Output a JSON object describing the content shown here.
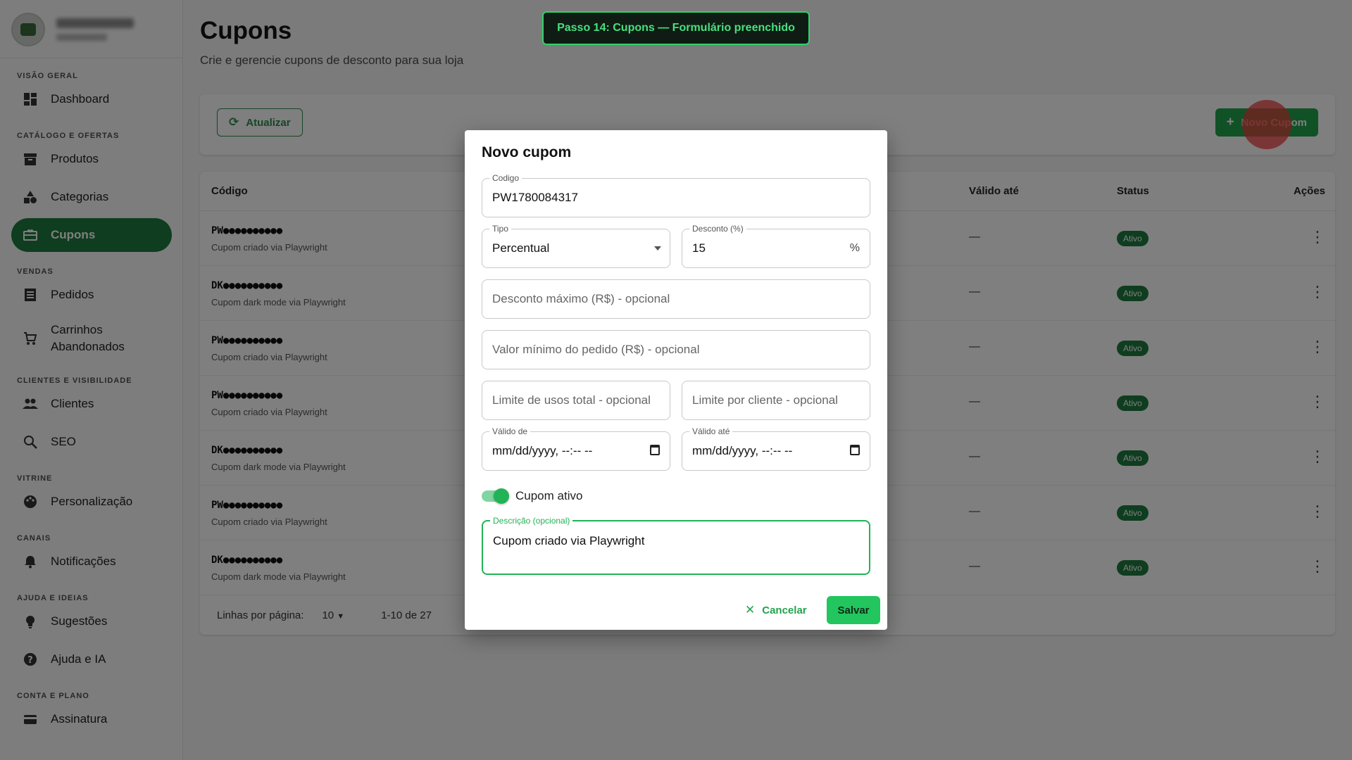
{
  "sidebar": {
    "sections": [
      {
        "label": "VISÃO GERAL",
        "items": [
          {
            "label": "Dashboard",
            "icon": "dashboard-icon"
          }
        ]
      },
      {
        "label": "CATÁLOGO E OFERTAS",
        "items": [
          {
            "label": "Produtos",
            "icon": "archive-icon"
          },
          {
            "label": "Categorias",
            "icon": "category-icon"
          },
          {
            "label": "Cupons",
            "icon": "coupon-icon"
          }
        ]
      },
      {
        "label": "VENDAS",
        "items": [
          {
            "label": "Pedidos",
            "icon": "list-icon"
          },
          {
            "label": "Carrinhos Abandonados",
            "icon": "cart-icon"
          }
        ]
      },
      {
        "label": "CLIENTES E VISIBILIDADE",
        "items": [
          {
            "label": "Clientes",
            "icon": "people-icon"
          },
          {
            "label": "SEO",
            "icon": "search-icon"
          }
        ]
      },
      {
        "label": "VITRINE",
        "items": [
          {
            "label": "Personalização",
            "icon": "palette-icon"
          }
        ]
      },
      {
        "label": "CANAIS",
        "items": [
          {
            "label": "Notificações",
            "icon": "bell-icon"
          }
        ]
      },
      {
        "label": "AJUDA E IDEIAS",
        "items": [
          {
            "label": "Sugestões",
            "icon": "lightbulb-icon"
          },
          {
            "label": "Ajuda e IA",
            "icon": "help-icon"
          }
        ]
      },
      {
        "label": "CONTA E PLANO",
        "items": [
          {
            "label": "Assinatura",
            "icon": "card-icon"
          }
        ]
      }
    ],
    "active": "Cupons"
  },
  "page": {
    "title": "Cupons",
    "subtitle": "Crie e gerencie cupons de desconto para sua loja",
    "refresh_label": "Atualizar",
    "new_label": "Novo Cupom"
  },
  "table": {
    "columns": {
      "code": "Código",
      "valid_until": "Válido até",
      "status": "Status",
      "actions": "Ações"
    },
    "rows": [
      {
        "code": "PW●●●●●●●●●●",
        "description": "Cupom criado via Playwright",
        "valid_until": "—",
        "status": "Ativo"
      },
      {
        "code": "DK●●●●●●●●●●",
        "description": "Cupom dark mode via Playwright",
        "valid_until": "—",
        "status": "Ativo"
      },
      {
        "code": "PW●●●●●●●●●●",
        "description": "Cupom criado via Playwright",
        "valid_until": "—",
        "status": "Ativo"
      },
      {
        "code": "PW●●●●●●●●●●",
        "description": "Cupom criado via Playwright",
        "valid_until": "—",
        "status": "Ativo"
      },
      {
        "code": "DK●●●●●●●●●●",
        "description": "Cupom dark mode via Playwright",
        "valid_until": "—",
        "status": "Ativo"
      },
      {
        "code": "PW●●●●●●●●●●",
        "description": "Cupom criado via Playwright",
        "valid_until": "—",
        "status": "Ativo"
      },
      {
        "code": "DK●●●●●●●●●●",
        "description": "Cupom dark mode via Playwright",
        "valid_until": "—",
        "status": "Ativo"
      }
    ],
    "footer": {
      "rows_per_page_label": "Linhas por página:",
      "rows_per_page": "10",
      "range": "1-10 de 27"
    }
  },
  "step_banner": "Passo 14: Cupons — Formulário preenchido",
  "dialog": {
    "title": "Novo cupom",
    "code": {
      "label": "Codigo",
      "value": "PW1780084317"
    },
    "type": {
      "label": "Tipo",
      "value": "Percentual"
    },
    "discount": {
      "label": "Desconto (%)",
      "value": "15",
      "suffix": "%"
    },
    "max_discount": {
      "placeholder": "Desconto máximo (R$) - opcional"
    },
    "min_order": {
      "placeholder": "Valor mínimo do pedido (R$) - opcional"
    },
    "usage_total": {
      "placeholder": "Limite de usos total - opcional"
    },
    "usage_per_customer": {
      "placeholder": "Limite por cliente - opcional"
    },
    "valid_from": {
      "label": "Válido de",
      "value": "mm/dd/yyyy, --:-- --"
    },
    "valid_until": {
      "label": "Válido até",
      "value": "mm/dd/yyyy, --:-- --"
    },
    "active_toggle": {
      "label": "Cupom ativo",
      "on": true
    },
    "description": {
      "label": "Descrição (opcional)",
      "value": "Cupom criado via Playwright"
    },
    "cancel_label": "Cancelar",
    "save_label": "Salvar"
  },
  "colors": {
    "primary": "#1f7a3f",
    "accent": "#22c55e",
    "banner_border": "#2fd36b"
  }
}
